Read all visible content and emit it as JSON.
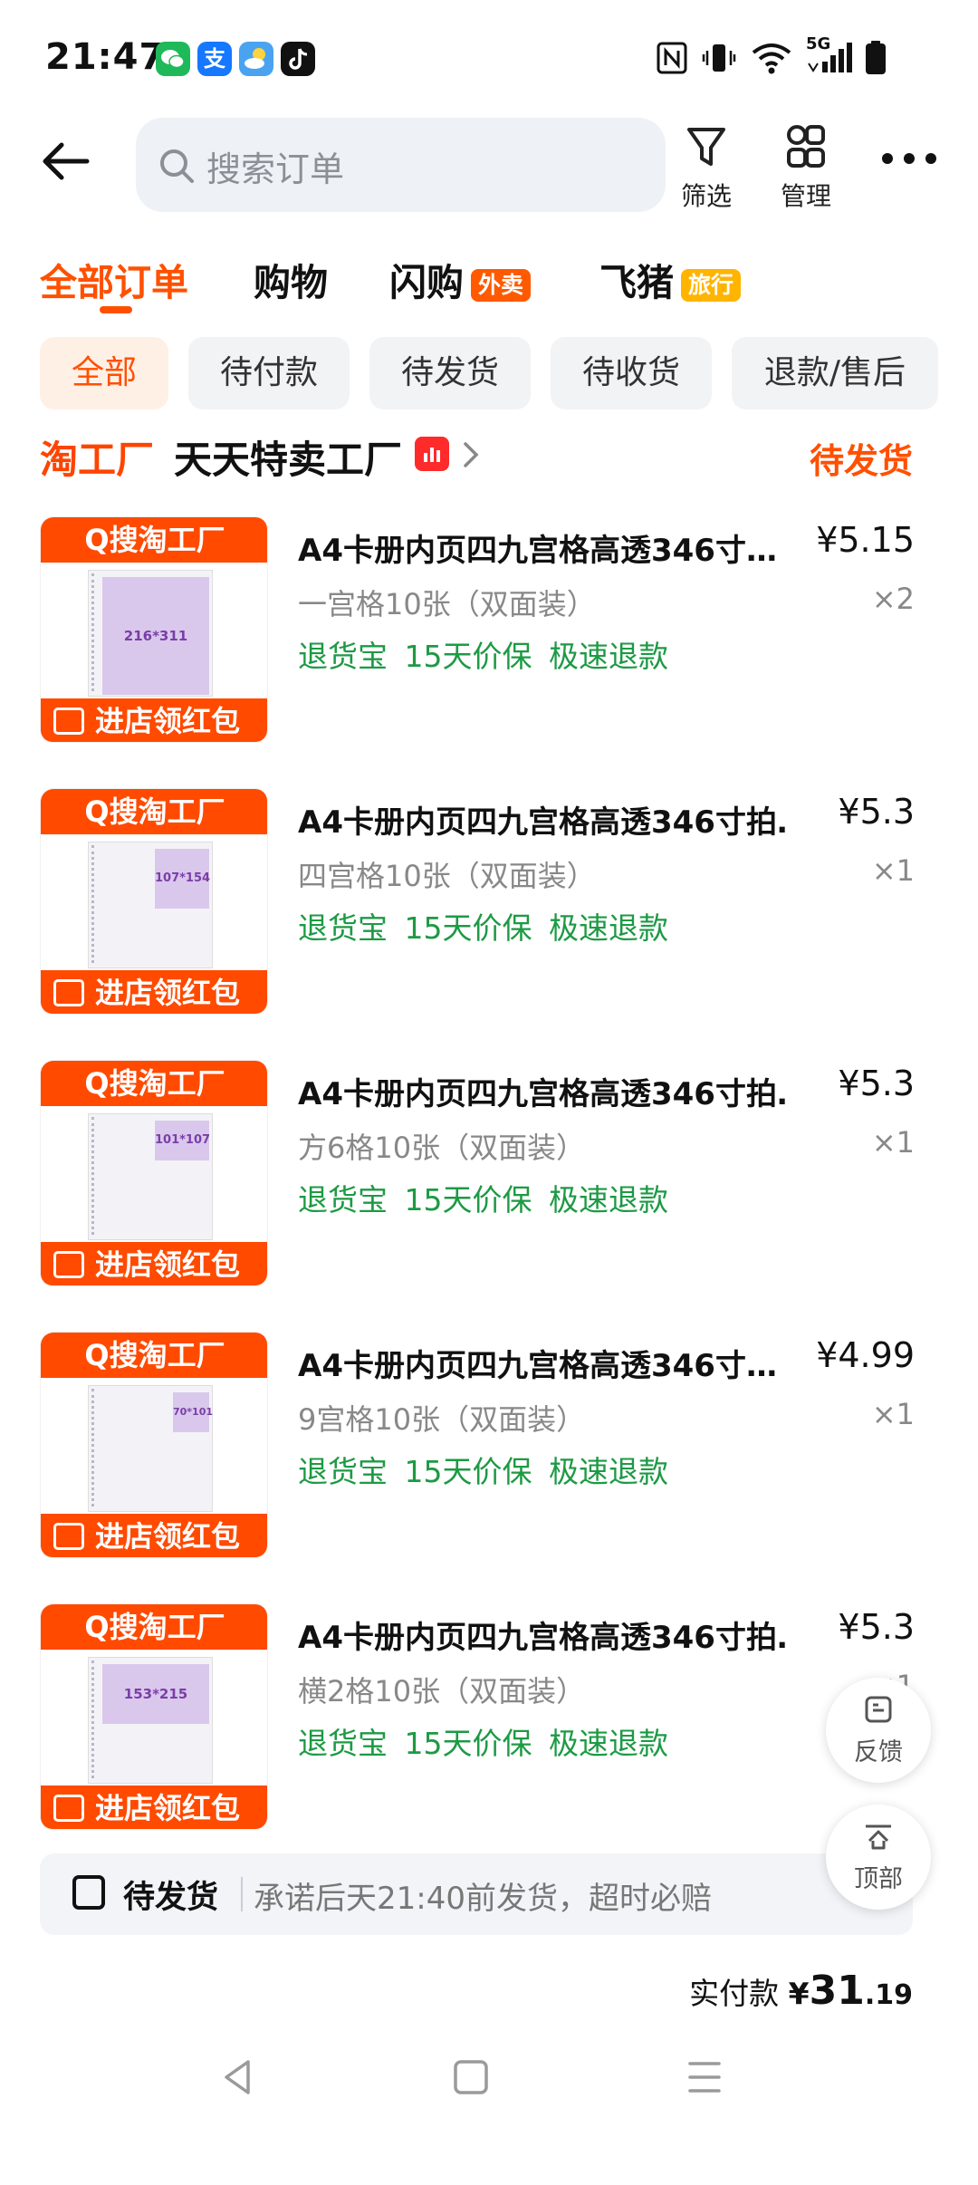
{
  "status_bar": {
    "time": "21:47",
    "apps": [
      {
        "icon": "wechat-icon",
        "color": "#1fb95a"
      },
      {
        "icon": "alipay-icon",
        "color": "#1677ff",
        "text": "支"
      },
      {
        "icon": "weather-icon",
        "color": "#4aa3f0"
      },
      {
        "icon": "tiktok-icon",
        "color": "#111111"
      }
    ],
    "network": "5G"
  },
  "header": {
    "search_placeholder": "搜索订单",
    "filter_label": "筛选",
    "manage_label": "管理"
  },
  "tabs": [
    {
      "label": "全部订单",
      "active": true
    },
    {
      "label": "购物"
    },
    {
      "label": "闪购",
      "tag": "外卖",
      "tag_color": "#ff5a00"
    },
    {
      "label": "飞猪",
      "tag": "旅行",
      "tag_color": "#ffb400"
    }
  ],
  "filters": [
    "全部",
    "待付款",
    "待发货",
    "待收货",
    "退款/售后"
  ],
  "store": {
    "logo_text": "淘工厂",
    "name": "天天特卖工厂",
    "status": "待发货"
  },
  "thumb_labels": {
    "top": "Q搜淘工厂",
    "bottom": "进店领红包"
  },
  "items": [
    {
      "title": "A4卡册内页四九宫格高透346寸…",
      "price": "¥5.15",
      "spec": "一宫格10张（双面装）",
      "qty": "×2",
      "services": "退货宝 15天价保 极速退款",
      "thumb_dim": "216*311"
    },
    {
      "title": "A4卡册内页四九宫格高透346寸拍…",
      "price": "¥5.3",
      "spec": "四宫格10张（双面装）",
      "qty": "×1",
      "services": "退货宝 15天价保 极速退款",
      "thumb_dim": "107*154"
    },
    {
      "title": "A4卡册内页四九宫格高透346寸拍…",
      "price": "¥5.3",
      "spec": "方6格10张（双面装）",
      "qty": "×1",
      "services": "退货宝 15天价保 极速退款",
      "thumb_dim": "101*107"
    },
    {
      "title": "A4卡册内页四九宫格高透346寸…",
      "price": "¥4.99",
      "spec": "9宫格10张（双面装）",
      "qty": "×1",
      "services": "退货宝 15天价保 极速退款",
      "thumb_dim": "70*101"
    },
    {
      "title": "A4卡册内页四九宫格高透346寸拍…",
      "price": "¥5.3",
      "spec": "横2格10张（双面装）",
      "qty": "×1",
      "services": "退货宝 15天价保 极速退款",
      "thumb_dim": "153*215"
    }
  ],
  "shipping": {
    "title": "待发货",
    "text": "承诺后天21:40前发货，超时必赔"
  },
  "total": {
    "label": "实付款",
    "currency": "¥",
    "amount": "31",
    "cents": ".19"
  },
  "floating": {
    "feedback": "反馈",
    "top": "顶部"
  },
  "colors": {
    "accent": "#ff5000",
    "service_green": "#1d9a44"
  }
}
